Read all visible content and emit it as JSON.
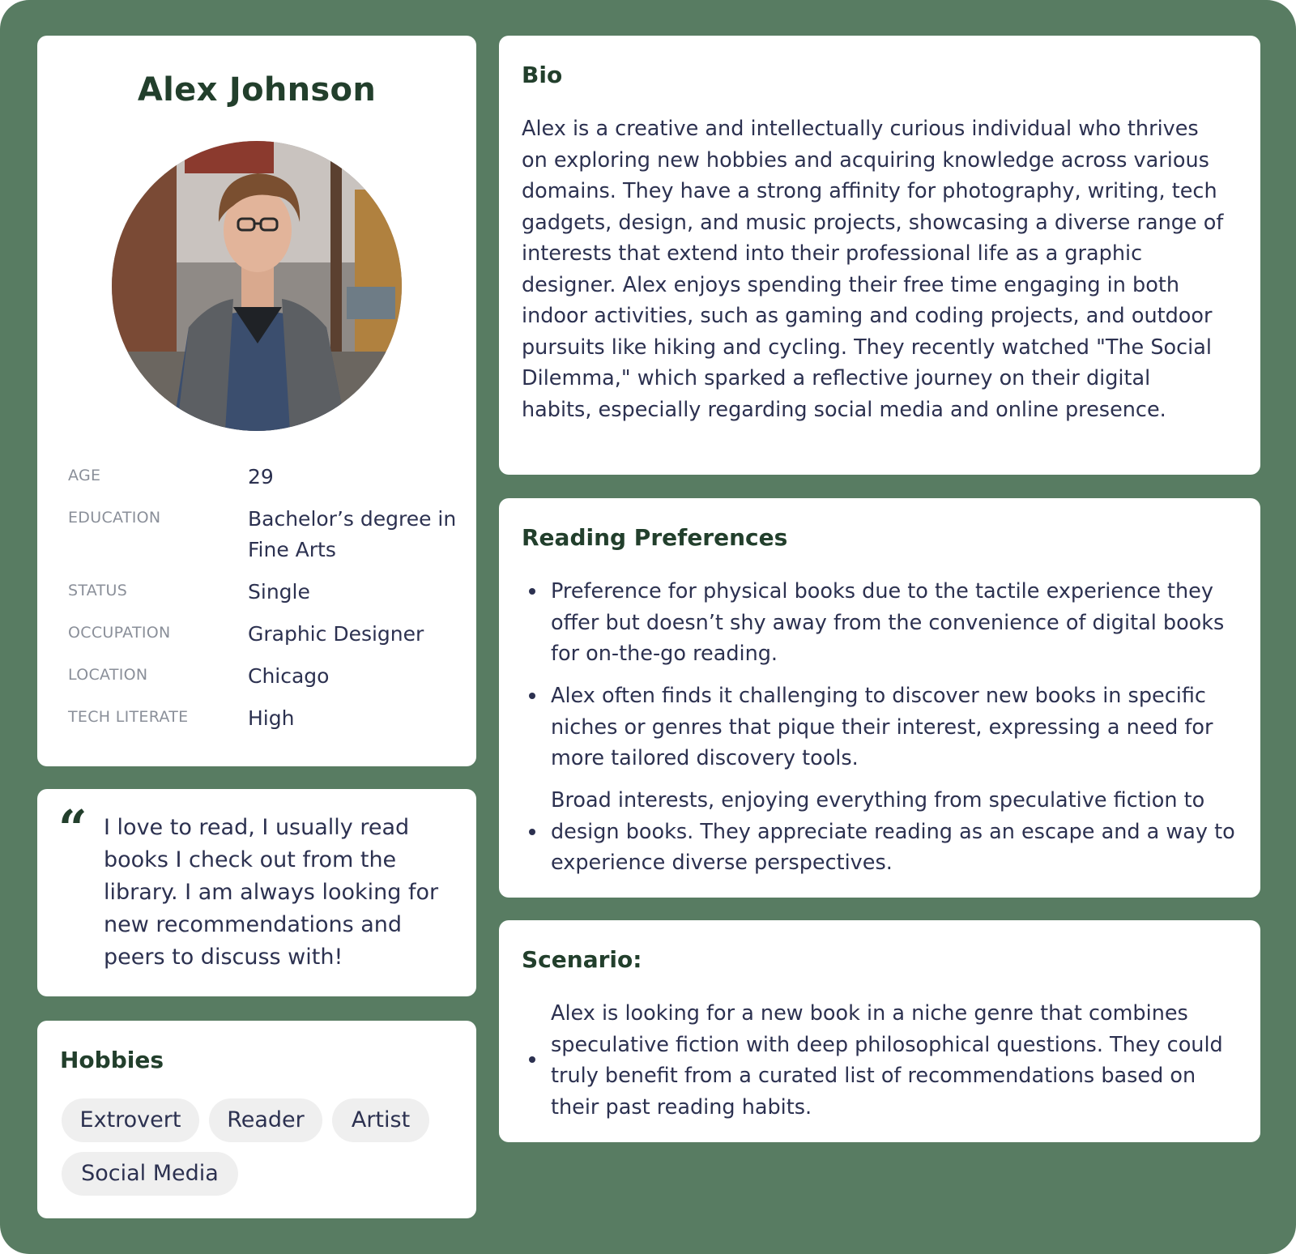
{
  "profile": {
    "name": "Alex Johnson",
    "details": [
      {
        "label": "AGE",
        "value": "29"
      },
      {
        "label": "EDUCATION",
        "value": "Bachelor’s degree in Fine Arts"
      },
      {
        "label": "STATUS",
        "value": "Single"
      },
      {
        "label": "OCCUPATION",
        "value": "Graphic Designer"
      },
      {
        "label": "LOCATION",
        "value": "Chicago"
      },
      {
        "label": "TECH  LITERATE",
        "value": "High"
      }
    ]
  },
  "quote": {
    "mark": "“",
    "text": "I love to read, I usually read books I check out from the library. I am always looking for new recommendations and peers to discuss with!"
  },
  "hobbies": {
    "title": "Hobbies",
    "tags": [
      "Extrovert",
      "Reader",
      "Artist",
      "Social Media"
    ]
  },
  "bio": {
    "title": "Bio",
    "text": "Alex is a creative and intellectually curious individual who thrives on exploring new hobbies and acquiring knowledge across various domains. They have a strong affinity for photography, writing, tech gadgets, design, and music projects, showcasing a diverse range of interests that extend into their professional life as a graphic designer. Alex enjoys spending their free time engaging in both indoor activities, such as gaming and coding projects, and outdoor pursuits like hiking and cycling. They recently watched \"The Social Dilemma,\" which sparked a reflective journey on their digital habits, especially regarding social media and online presence."
  },
  "reading": {
    "title": "Reading Preferences",
    "items": [
      "Preference for physical books due to the tactile experience they offer but doesn’t shy away from the convenience of digital books for on-the-go reading.",
      "Alex often finds it challenging to discover new books in specific niches or genres that pique their interest, expressing a need for more tailored discovery tools.",
      "Broad interests, enjoying everything from speculative fiction to design books. They appreciate reading as an escape and a way to experience diverse perspectives."
    ]
  },
  "scenario": {
    "title": "Scenario:",
    "items": [
      "Alex is looking for a new book in a niche genre that combines speculative fiction with deep philosophical questions. They could truly benefit from a curated list of recommendations based on their past reading habits."
    ]
  },
  "colors": {
    "background": "#587c62",
    "heading": "#223f2c",
    "body_text": "#2c3150",
    "label": "#8a8f99",
    "chip": "#efefef"
  }
}
